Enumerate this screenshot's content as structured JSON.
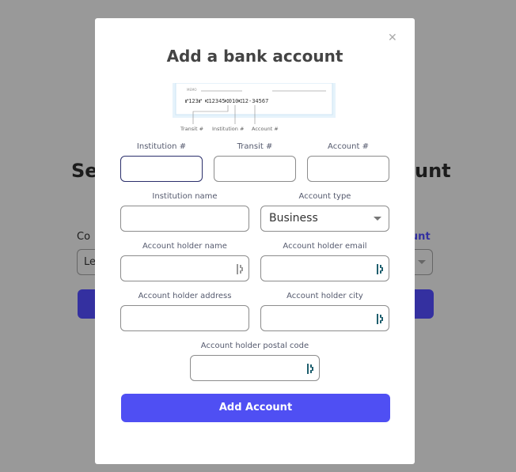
{
  "background": {
    "title_left": "Se",
    "title_right": "unt",
    "label_left": "Co",
    "link_right": "ount",
    "select_left": "Le"
  },
  "modal": {
    "title": "Add a bank account",
    "close_icon": "close-icon",
    "cheque": {
      "memo": "MEMO",
      "micr": "⑈123⑈ ⑆12345⑆010⑆12-34567",
      "transit": "Transit #",
      "institution": "Institution #",
      "account": "Account #"
    },
    "fields": {
      "institution_number": {
        "label": "Institution #",
        "value": ""
      },
      "transit_number": {
        "label": "Transit #",
        "value": ""
      },
      "account_number": {
        "label": "Account #",
        "value": ""
      },
      "institution_name": {
        "label": "Institution name",
        "value": ""
      },
      "account_type": {
        "label": "Account type",
        "value": "Business"
      },
      "holder_name": {
        "label": "Account holder name",
        "value": ""
      },
      "holder_email": {
        "label": "Account holder email",
        "value": ""
      },
      "holder_address": {
        "label": "Account holder address",
        "value": ""
      },
      "holder_city": {
        "label": "Account holder city",
        "value": ""
      },
      "holder_postal": {
        "label": "Account holder postal code",
        "value": ""
      }
    },
    "submit_label": "Add Account"
  },
  "colors": {
    "accent": "#4f4ff3",
    "password_manager_icon": "#1f5f6e"
  }
}
